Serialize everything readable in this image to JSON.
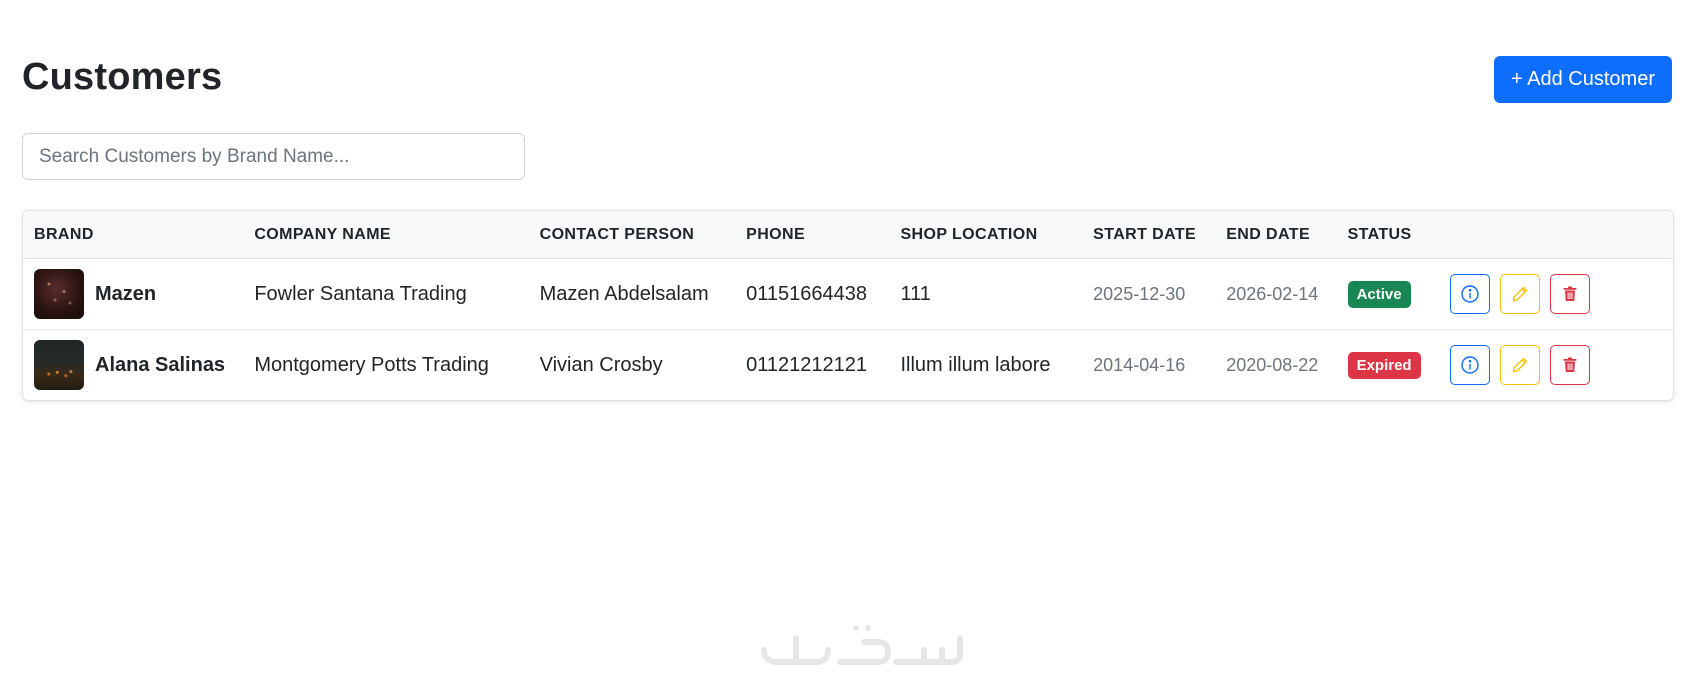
{
  "header": {
    "title": "Customers",
    "add_button_label": "+ Add Customer"
  },
  "search": {
    "placeholder": "Search Customers by Brand Name..."
  },
  "table": {
    "columns": [
      "BRAND",
      "COMPANY NAME",
      "CONTACT PERSON",
      "PHONE",
      "SHOP LOCATION",
      "START DATE",
      "END DATE",
      "STATUS",
      ""
    ],
    "rows": [
      {
        "brand": "Mazen",
        "company": "Fowler Santana Trading",
        "contact": "Mazen Abdelsalam",
        "phone": "01151664438",
        "location": "111",
        "start_date": "2025-12-30",
        "end_date": "2026-02-14",
        "status": "Active",
        "status_color": "#198754"
      },
      {
        "brand": "Alana Salinas",
        "company": "Montgomery Potts Trading",
        "contact": "Vivian Crosby",
        "phone": "01121212121",
        "location": "Illum illum labore",
        "start_date": "2014-04-16",
        "end_date": "2020-08-22",
        "status": "Expired",
        "status_color": "#dc3545"
      }
    ]
  },
  "icons": {
    "info": "info-circle-icon",
    "edit": "pencil-icon",
    "delete": "trash-icon"
  },
  "colors": {
    "primary": "#0d6efd",
    "warning": "#ffc107",
    "danger": "#dc3545",
    "success": "#198754"
  }
}
